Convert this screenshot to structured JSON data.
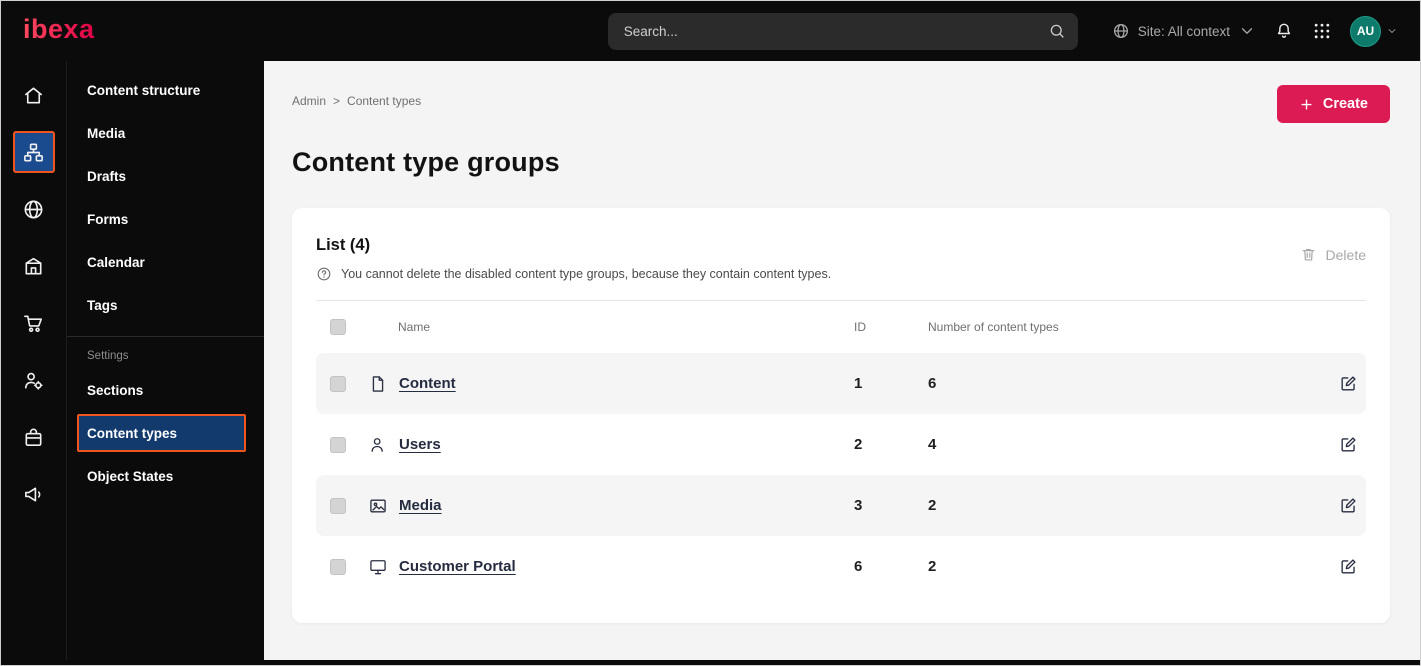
{
  "topbar": {
    "logo": "ibexa",
    "search_placeholder": "Search...",
    "site_context": "Site: All context",
    "avatar": "AU",
    "icons": [
      "globe-icon",
      "chevron-down-icon",
      "bell-icon",
      "grid-icon"
    ]
  },
  "icon_rail": {
    "items": [
      {
        "icon": "home-icon",
        "active": false
      },
      {
        "icon": "sitemap-icon",
        "active": true
      },
      {
        "icon": "globe-icon",
        "active": false
      },
      {
        "icon": "building-icon",
        "active": false
      },
      {
        "icon": "cart-icon",
        "active": false
      },
      {
        "icon": "user-settings-icon",
        "active": false
      },
      {
        "icon": "briefcase-icon",
        "active": false
      },
      {
        "icon": "megaphone-icon",
        "active": false
      }
    ]
  },
  "sidebar": {
    "items": [
      "Content structure",
      "Media",
      "Drafts",
      "Forms",
      "Calendar",
      "Tags"
    ],
    "section_label": "Settings",
    "settings_items": [
      "Sections",
      "Content types",
      "Object States"
    ],
    "active_item": "Content types"
  },
  "main": {
    "breadcrumb": {
      "parent": "Admin",
      "separator": ">",
      "current": "Content types"
    },
    "create_label": "Create",
    "page_title": "Content type groups",
    "panel": {
      "list_title": "List (4)",
      "info_icon": "question-circle-icon",
      "info_text": "You cannot delete the disabled content type groups, because they contain content types.",
      "delete_label": "Delete",
      "delete_icon": "trash-icon",
      "table": {
        "columns": [
          "Name",
          "ID",
          "Number of content types"
        ],
        "rows": [
          {
            "icon": "file-icon",
            "name": "Content",
            "id": "1",
            "count": "6"
          },
          {
            "icon": "user-icon",
            "name": "Users",
            "id": "2",
            "count": "4"
          },
          {
            "icon": "image-icon",
            "name": "Media",
            "id": "3",
            "count": "2"
          },
          {
            "icon": "monitor-icon",
            "name": "Customer Portal",
            "id": "6",
            "count": "2"
          }
        ]
      }
    }
  },
  "colors": {
    "accent": "#dc1a54",
    "active_border": "#f0551e",
    "active_bg": "#123a6d",
    "rail_active_bg": "#1b4b8f",
    "avatar_bg": "#0e7a6b",
    "topbar_bg": "#0b0b0b",
    "logo_start": "#ff4a5f",
    "logo_end": "#e00046"
  }
}
